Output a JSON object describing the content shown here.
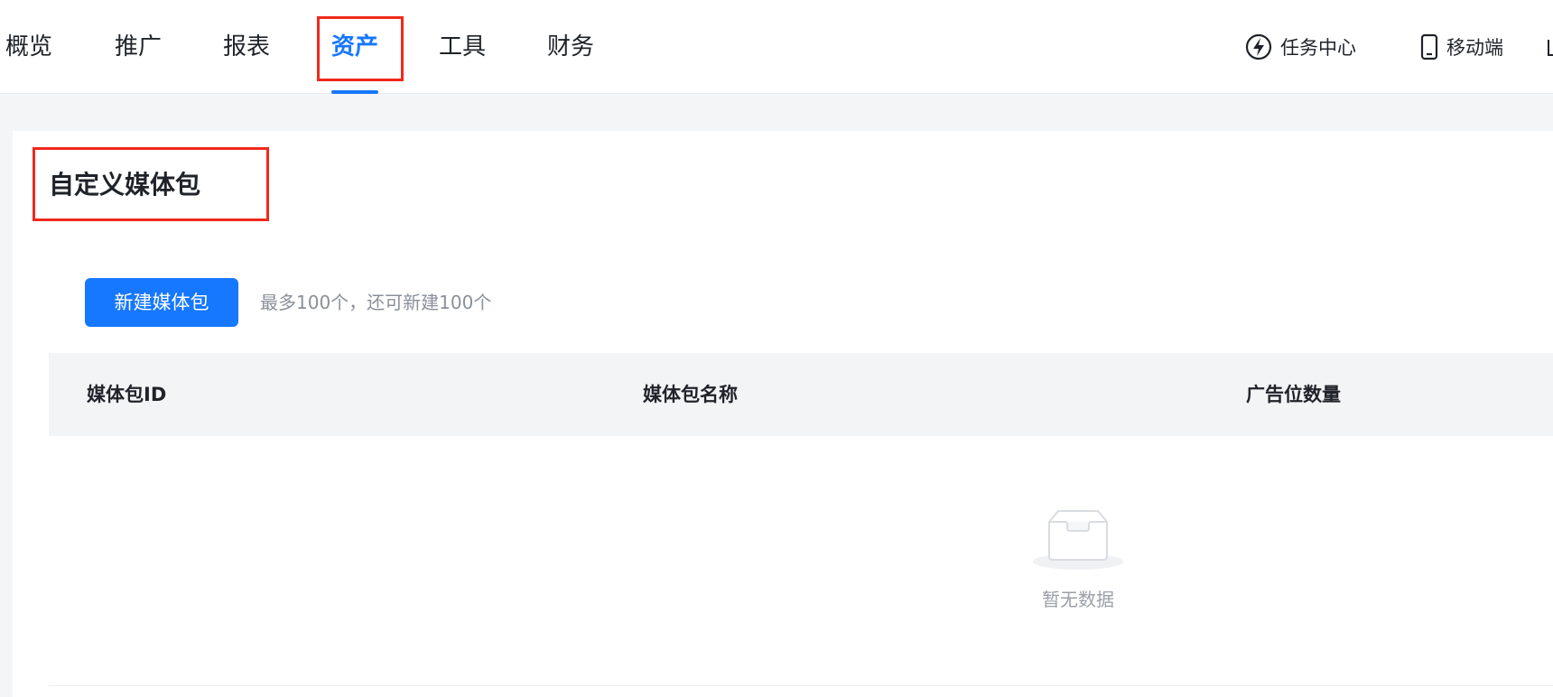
{
  "nav": {
    "tabs": [
      {
        "label": "概览"
      },
      {
        "label": "推广"
      },
      {
        "label": "报表"
      },
      {
        "label": "资产",
        "active": true
      },
      {
        "label": "工具"
      },
      {
        "label": "财务"
      }
    ],
    "task_center": {
      "label": "任务中心",
      "icon": "lightning-icon"
    },
    "mobile": {
      "label": "移动端",
      "icon": "mobile-phone-icon"
    }
  },
  "page": {
    "title": "自定义媒体包",
    "create_button": "新建媒体包",
    "create_hint": "最多100个，还可新建100个"
  },
  "table": {
    "columns": [
      "媒体包ID",
      "媒体包名称",
      "广告位数量"
    ],
    "rows": [],
    "empty_text": "暂无数据",
    "empty_icon": "empty-inbox-icon"
  },
  "colors": {
    "accent": "#1677ff",
    "highlight_box": "#f0291c"
  }
}
